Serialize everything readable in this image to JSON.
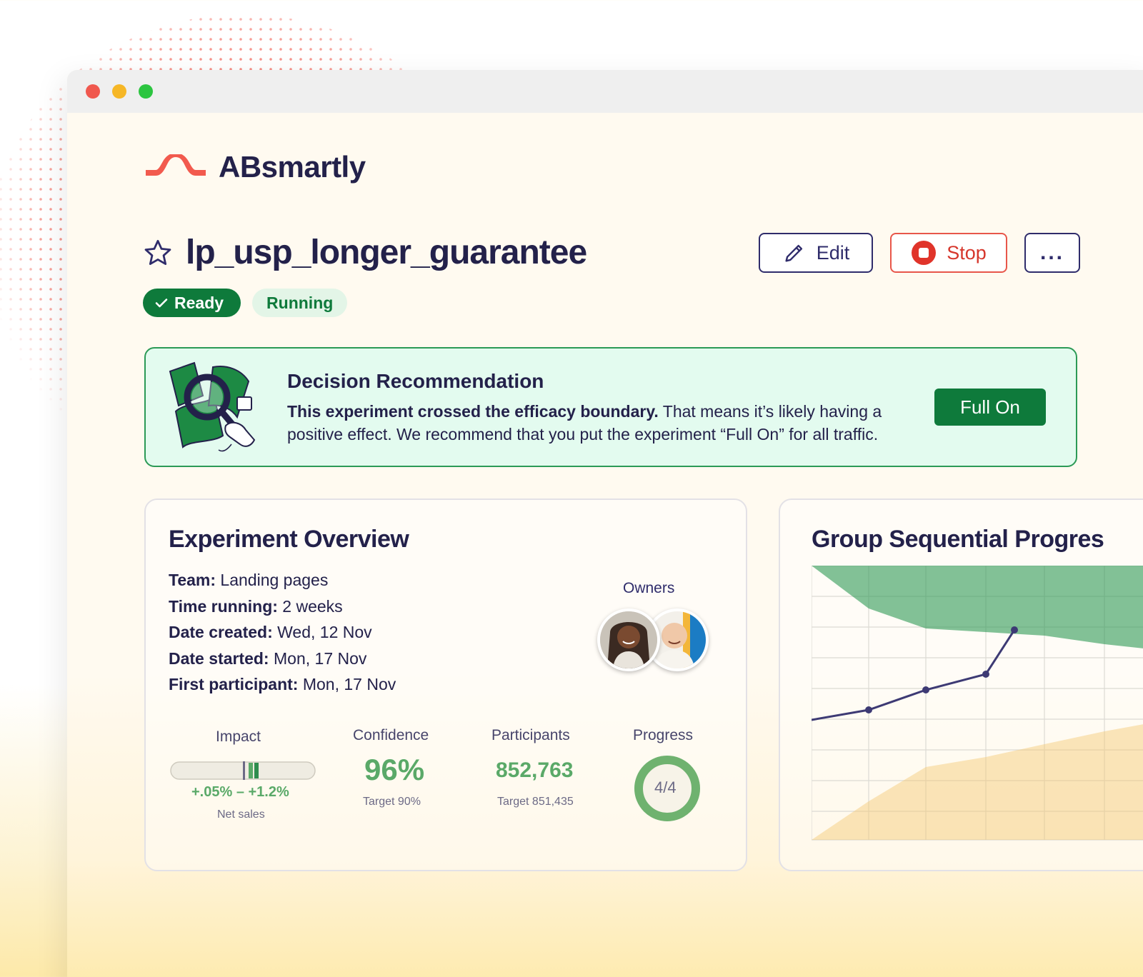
{
  "brand": {
    "name": "ABsmartly"
  },
  "experiment": {
    "title": "lp_usp_longer_guarantee",
    "status_ready": "Ready",
    "status_running": "Running"
  },
  "actions": {
    "edit": "Edit",
    "stop": "Stop",
    "more": "..."
  },
  "recommendation": {
    "title": "Decision Recommendation",
    "body_bold": "This experiment crossed the efficacy boundary.",
    "body_rest": " That means it’s likely having a positive effect. We recommend that you put the experiment “Full On” for all traffic.",
    "button": "Full On"
  },
  "overview": {
    "title": "Experiment Overview",
    "fields": [
      {
        "key": "Team:",
        "value": " Landing pages"
      },
      {
        "key": "Time running:",
        "value": " 2 weeks"
      },
      {
        "key": "Date created:",
        "value": " Wed, 12 Nov"
      },
      {
        "key": "Date started:",
        "value": " Mon, 17 Nov"
      },
      {
        "key": "First participant:",
        "value": " Mon, 17 Nov"
      }
    ],
    "owners_label": "Owners",
    "impact": {
      "label": "Impact",
      "range": "+.05% – +1.2%",
      "metric": "Net sales"
    },
    "confidence": {
      "label": "Confidence",
      "value": "96%",
      "target": "Target 90%"
    },
    "participants": {
      "label": "Participants",
      "value": "852,763",
      "target": "Target 851,435"
    },
    "progress": {
      "label": "Progress",
      "value": "4/4",
      "fraction": 1.0
    }
  },
  "gsp": {
    "title": "Group Sequential Progres"
  },
  "colors": {
    "brand_red": "#f25a4e",
    "navy": "#23214a",
    "green": "#0e7a3b",
    "light_green": "#5aa968"
  }
}
